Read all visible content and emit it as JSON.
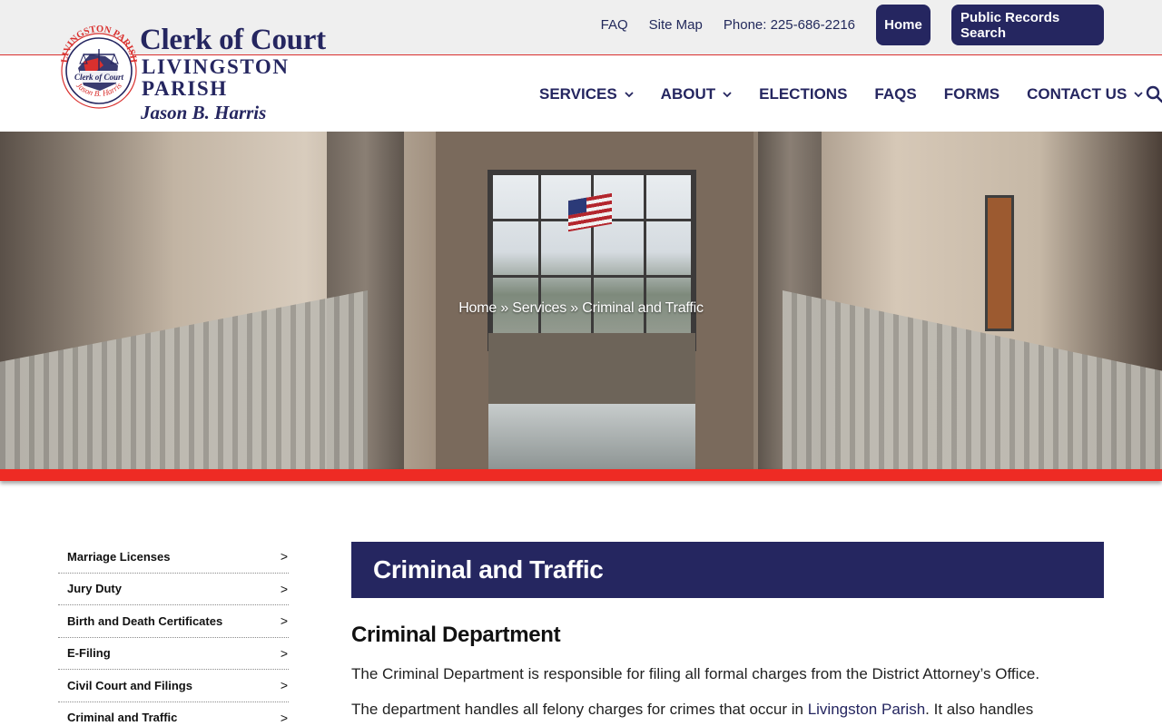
{
  "utility_nav": {
    "faq": "FAQ",
    "site_map": "Site Map",
    "phone": "Phone: 225-686-2216",
    "home_button": "Home",
    "records_button": "Public Records Search"
  },
  "logo": {
    "title": "Clerk of Court",
    "subtitle": "LIVINGSTON PARISH",
    "name": "Jason B. Harris",
    "seal_top_text": "LIVINGSTON PARISH",
    "seal_center_text": "Clerk of Court",
    "seal_bottom_text": "Jason B. Harris"
  },
  "main_nav": {
    "items": [
      {
        "label": "SERVICES",
        "has_dropdown": true
      },
      {
        "label": "ABOUT",
        "has_dropdown": true
      },
      {
        "label": "ELECTIONS",
        "has_dropdown": false
      },
      {
        "label": "FAQS",
        "has_dropdown": false
      },
      {
        "label": "FORMS",
        "has_dropdown": false
      },
      {
        "label": "CONTACT US",
        "has_dropdown": true
      }
    ],
    "search_icon": "search-icon"
  },
  "hero": {
    "breadcrumb": {
      "home": "Home",
      "sep1": " » ",
      "services": "Services",
      "sep2": " » ",
      "current": "Criminal and Traffic"
    }
  },
  "sidebar": {
    "items": [
      {
        "label": "Marriage Licenses",
        "arrow": ">"
      },
      {
        "label": "Jury Duty",
        "arrow": ">"
      },
      {
        "label": "Birth and Death Certificates",
        "arrow": ">"
      },
      {
        "label": "E-Filing",
        "arrow": ">"
      },
      {
        "label": "Civil Court and Filings",
        "arrow": ">"
      },
      {
        "label": "Criminal and Traffic",
        "arrow": ">"
      }
    ]
  },
  "content": {
    "page_title": "Criminal and Traffic",
    "section_heading": "Criminal Department",
    "para1": "The Criminal Department is responsible for filing all formal charges from the District Attorney’s Office.",
    "para2_start": "The department handles all felony charges for crimes that occur in ",
    "para2_link": "Livingston Parish",
    "para2_end": ". It also handles"
  },
  "colors": {
    "brand_navy": "#252660",
    "accent_red": "#ee2b24",
    "topbar_bg": "#efefef"
  }
}
